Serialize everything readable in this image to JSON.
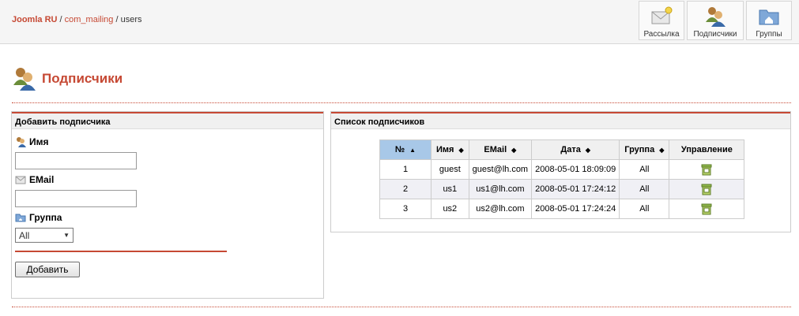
{
  "breadcrumb": {
    "site": "Joomla RU",
    "component": "com_mailing",
    "current": "users",
    "separator": "/"
  },
  "toolbar": {
    "items": [
      {
        "label": "Рассылка",
        "icon": "mail-icon"
      },
      {
        "label": "Подписчики",
        "icon": "users-icon"
      },
      {
        "label": "Группы",
        "icon": "folder-icon"
      }
    ]
  },
  "page": {
    "title": "Подписчики"
  },
  "add_form": {
    "header": "Добавить подписчика",
    "name_label": "Имя",
    "name_value": "",
    "email_label": "EMail",
    "email_value": "",
    "group_label": "Группа",
    "group_selected": "All",
    "submit_label": "Добавить"
  },
  "list": {
    "header": "Список подписчиков",
    "columns": [
      "№",
      "Имя",
      "EMail",
      "Дата",
      "Группа",
      "Управление"
    ],
    "rows": [
      {
        "num": "1",
        "name": "guest",
        "email": "guest@lh.com",
        "date": "2008-05-01 18:09:09",
        "group": "All"
      },
      {
        "num": "2",
        "name": "us1",
        "email": "us1@lh.com",
        "date": "2008-05-01 17:24:12",
        "group": "All"
      },
      {
        "num": "3",
        "name": "us2",
        "email": "us2@lh.com",
        "date": "2008-05-01 17:24:24",
        "group": "All"
      }
    ]
  },
  "colors": {
    "accent": "#c64934",
    "sorted_header": "#a8c8e8"
  }
}
